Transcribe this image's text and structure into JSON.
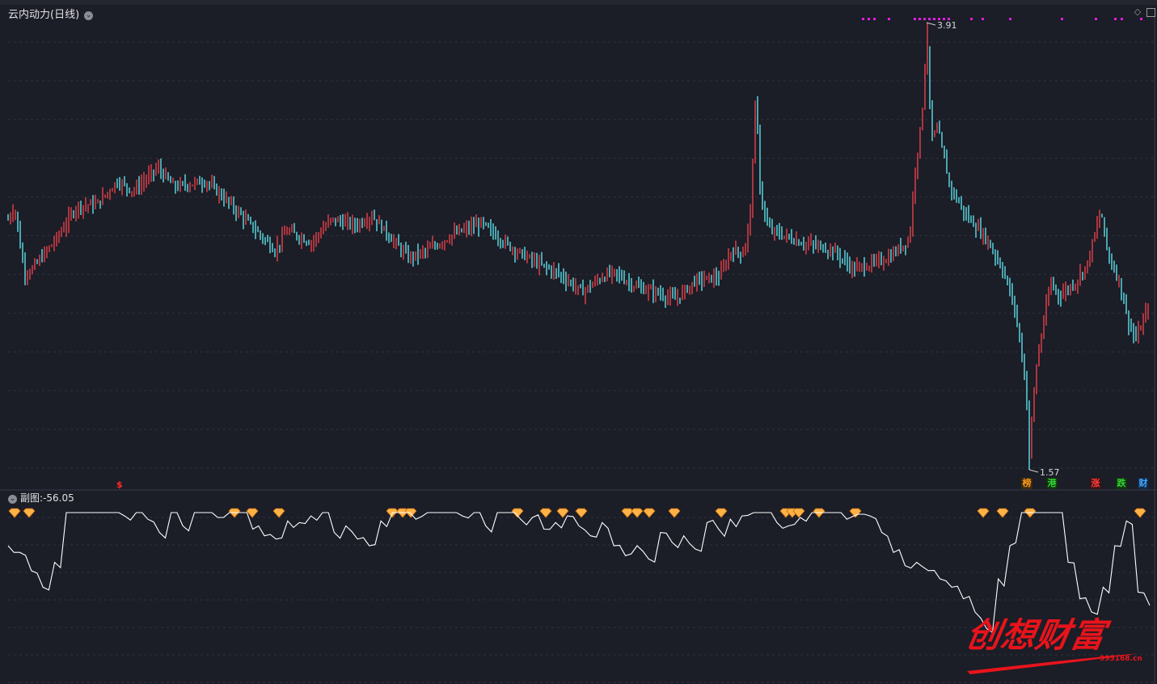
{
  "main_panel": {
    "title": "云内动力(日线)",
    "high_label": "3.91",
    "low_label": "1.57",
    "signal_mark": "$"
  },
  "sub_panel": {
    "title": "副图",
    "value_label": ":-56.05"
  },
  "badges": [
    {
      "label": "榜",
      "color": "#ff9a1a",
      "bg": "#3a2a10"
    },
    {
      "label": "港",
      "color": "#33d633",
      "bg": "#113311"
    },
    {
      "label": "涨",
      "color": "#ff3b3b",
      "bg": "#3a1414"
    },
    {
      "label": "跌",
      "color": "#33d633",
      "bg": "#113311"
    },
    {
      "label": "财",
      "color": "#46a3ff",
      "bg": "#102a44"
    }
  ],
  "watermark": {
    "text": "创想财富",
    "url": "995168.cn"
  },
  "colors": {
    "background": "#1b1d27",
    "grid": "#2f323d",
    "up": "#e8414a",
    "down": "#5fe0e8",
    "indicator_line": "#ffffff",
    "top_markers": "#e01ee0",
    "diamond": "#ffb347"
  },
  "chart_data": {
    "type": "candlestick",
    "title": "云内动力(日线)",
    "y_range": [
      1.57,
      3.91
    ],
    "price_high": 3.91,
    "price_low": 1.57,
    "sub_indicator": {
      "name": "副图",
      "last_value": -56.05,
      "series": [
        -20,
        -24,
        -35,
        -45,
        -30,
        0,
        0,
        0,
        0,
        0,
        -2,
        0,
        -4,
        -12,
        0,
        -8,
        0,
        0,
        -3,
        0,
        0,
        -10,
        -14,
        -16,
        -5,
        -6,
        -2,
        0,
        -12,
        -8,
        -16,
        -20,
        -5,
        0,
        0,
        -4,
        0,
        0,
        0,
        -2,
        0,
        -8,
        0,
        0,
        -4,
        -3,
        -10,
        -6,
        -2,
        -8,
        -14,
        -6,
        -20,
        -26,
        -20,
        -28,
        -12,
        -18,
        -14,
        -22,
        -6,
        -10,
        -4,
        -2,
        0,
        0,
        -6,
        -8,
        -3,
        0,
        0,
        0,
        -4,
        -1,
        -2,
        -12,
        -24,
        -32,
        -30,
        -35,
        -40,
        -45,
        -52,
        -60,
        -70,
        -40,
        -20,
        0,
        0,
        0,
        0,
        -30,
        -52,
        -60,
        -45,
        -20,
        -5,
        -48,
        -56
      ]
    },
    "signals": [
      {
        "type": "top_marker",
        "count": 16
      },
      {
        "type": "bottom_diamond",
        "count": 25
      }
    ]
  }
}
